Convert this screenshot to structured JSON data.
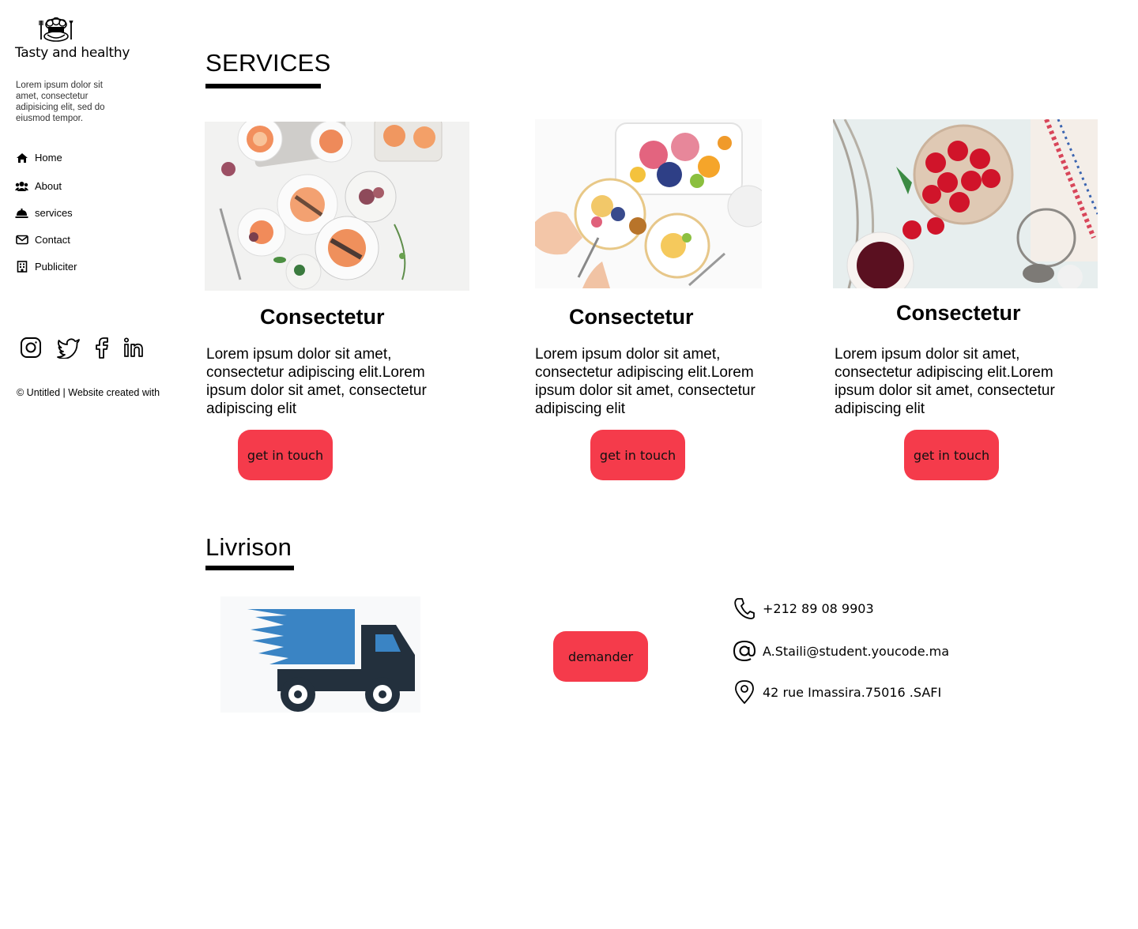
{
  "sidebar": {
    "brand": "Tasty and healthy",
    "intro": "Lorem ipsum dolor sit amet, consectetur adipisicing elit, sed do eiusmod tempor.",
    "nav": [
      {
        "label": "Home",
        "icon": "home-icon"
      },
      {
        "label": "About",
        "icon": "users-icon"
      },
      {
        "label": "services",
        "icon": "service-bell-icon"
      },
      {
        "label": "Contact",
        "icon": "mail-icon"
      },
      {
        "label": "Publiciter",
        "icon": "building-icon"
      }
    ],
    "socials": [
      "instagram-icon",
      "twitter-icon",
      "facebook-icon",
      "linkedin-icon"
    ],
    "footer": "© Untitled | Website created with"
  },
  "services": {
    "title": "SERVICES",
    "cards": [
      {
        "title": "Consectetur",
        "text": "Lorem ipsum dolor sit amet, consectetur adipiscing elit.Lorem ipsum dolor sit amet, consectetur adipiscing elit",
        "button": "get in touch"
      },
      {
        "title": "Consectetur",
        "text": "Lorem ipsum dolor sit amet, consectetur adipiscing elit.Lorem ipsum dolor sit amet, consectetur adipiscing elit",
        "button": "get in touch"
      },
      {
        "title": "Consectetur",
        "text": "Lorem ipsum dolor sit amet, consectetur adipiscing elit.Lorem ipsum dolor sit amet, consectetur adipiscing elit",
        "button": "get in touch"
      }
    ]
  },
  "livraison": {
    "title": "Livrison",
    "button": "demander",
    "phone": "+212 89 08 9903",
    "email": "A.Staili@student.youcode.ma",
    "address": "42 rue Imassira.75016 .SAFI"
  },
  "colors": {
    "accent": "#f53b4b",
    "truck_blue": "#3a84c4",
    "truck_dark": "#23303d"
  }
}
